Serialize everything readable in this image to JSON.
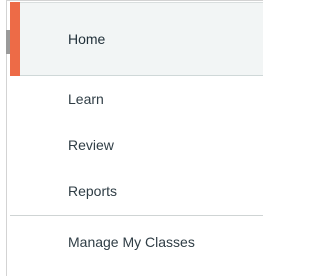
{
  "nav": {
    "items": [
      {
        "label": "Home",
        "active": true
      },
      {
        "label": "Learn"
      },
      {
        "label": "Review"
      },
      {
        "label": "Reports"
      },
      {
        "label": "Manage My Classes"
      }
    ]
  },
  "colors": {
    "active_accent": "#ed6b47",
    "active_background": "#f2f5f5",
    "text": "#2f3d45"
  }
}
